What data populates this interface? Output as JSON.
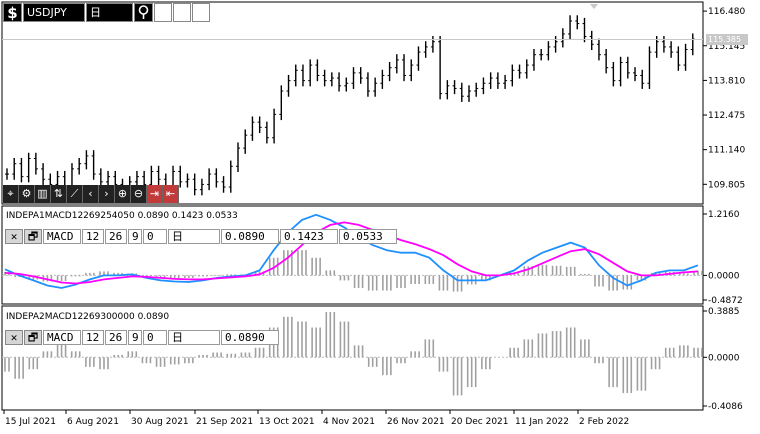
{
  "header": {
    "symbol_icon": "$",
    "symbol": "USDJPY",
    "timeframe": "日",
    "pin_icon": "map-pin-icon"
  },
  "price_axis": {
    "labels": [
      "116.480",
      "115.145",
      "113.810",
      "112.475",
      "111.140",
      "109.805"
    ],
    "current_price": "115.385",
    "current_value": 115.385
  },
  "toolbar": {
    "icons": [
      "crosshair-icon",
      "gear-icon",
      "bar-chart-icon",
      "sort-icon",
      "draw-line-icon",
      "scroll-left-icon",
      "scroll-right-icon",
      "zoom-in-icon",
      "zoom-out-icon",
      "arrow-in-icon",
      "arrow-out-icon"
    ]
  },
  "indicator1": {
    "title": "INDEPA1MACD12269254050 0.0890 0.1423 0.0533",
    "close_label": "✕",
    "window_label": "🗗",
    "name": "MACD",
    "params": [
      "12",
      "26",
      "9",
      "0"
    ],
    "timeframe": "日",
    "values": [
      "0.0890",
      "0.1423",
      "0.0533"
    ],
    "axis_labels": [
      "1.2160",
      "0.0000",
      "-0.4872"
    ]
  },
  "indicator2": {
    "title": "INDEPA2MACD12269300000 0.0890",
    "close_label": "✕",
    "window_label": "🗗",
    "name": "MACD",
    "params": [
      "12",
      "26",
      "9",
      "0"
    ],
    "timeframe": "日",
    "value": "0.0890",
    "axis_labels": [
      "0.3885",
      "0.0000",
      "-0.4086"
    ]
  },
  "time_axis": {
    "labels": [
      "15 Jul 2021",
      "6 Aug 2021",
      "30 Aug 2021",
      "21 Sep 2021",
      "13 Oct 2021",
      "4 Nov 2021",
      "26 Nov 2021",
      "20 Dec 2021",
      "11 Jan 2022",
      "2 Feb 2022"
    ]
  },
  "colors": {
    "macd_line": "#1e90ff",
    "signal_line": "#ff00ff",
    "histogram": "#a0a0a0",
    "candle": "#000000",
    "toolbar_red": "#c23b3b"
  },
  "chart_data": [
    {
      "type": "line",
      "title": "",
      "note_type": "candlestick",
      "series": [
        {
          "name": "USDJPY",
          "values": [
            110.2,
            110.6,
            110.1,
            110.8,
            110.4,
            110.0,
            109.8,
            110.1,
            109.7,
            110.4,
            110.6,
            110.9,
            110.2,
            109.9,
            110.1,
            109.8,
            109.6,
            109.9,
            110.1,
            109.8,
            110.3,
            110.0,
            109.7,
            110.3,
            109.9,
            110.0,
            109.6,
            109.8,
            110.2,
            109.9,
            109.7,
            110.5,
            111.2,
            111.7,
            112.2,
            112.0,
            111.6,
            112.5,
            113.4,
            113.8,
            114.2,
            113.8,
            114.4,
            114.0,
            113.8,
            113.9,
            113.6,
            113.7,
            114.1,
            113.9,
            113.4,
            113.7,
            114.0,
            114.3,
            114.6,
            114.0,
            114.4,
            114.9,
            115.1,
            115.3,
            113.3,
            113.6,
            113.5,
            113.2,
            113.4,
            113.5,
            113.7,
            113.9,
            113.7,
            113.8,
            114.2,
            114.1,
            114.4,
            114.8,
            114.8,
            115.1,
            115.3,
            115.6,
            116.1,
            116.0,
            115.5,
            115.2,
            114.8,
            114.3,
            113.8,
            114.5,
            114.1,
            114.0,
            113.7,
            114.9,
            115.3,
            115.1,
            114.9,
            114.4,
            115.0,
            115.4
          ]
        }
      ],
      "ylim": [
        109.2,
        116.6
      ]
    },
    {
      "type": "line",
      "title": "",
      "series": [
        {
          "name": "MACD",
          "values": [
            0.12,
            0.0,
            -0.1,
            -0.2,
            -0.25,
            -0.18,
            -0.08,
            0.0,
            0.0,
            0.02,
            -0.05,
            -0.1,
            -0.12,
            -0.13,
            -0.1,
            -0.05,
            -0.02,
            0.0,
            0.1,
            0.5,
            0.85,
            1.1,
            1.2,
            1.1,
            0.95,
            0.75,
            0.6,
            0.5,
            0.45,
            0.45,
            0.35,
            0.1,
            -0.1,
            -0.1,
            -0.1,
            0.0,
            0.1,
            0.3,
            0.45,
            0.55,
            0.65,
            0.55,
            0.2,
            -0.05,
            -0.2,
            -0.1,
            0.05,
            0.1,
            0.1,
            0.2
          ]
        },
        {
          "name": "Signal",
          "values": [
            0.05,
            0.03,
            -0.02,
            -0.08,
            -0.14,
            -0.16,
            -0.13,
            -0.08,
            -0.05,
            -0.02,
            -0.03,
            -0.05,
            -0.07,
            -0.08,
            -0.08,
            -0.06,
            -0.04,
            -0.02,
            0.02,
            0.15,
            0.35,
            0.6,
            0.85,
            1.0,
            1.05,
            1.0,
            0.9,
            0.8,
            0.7,
            0.62,
            0.52,
            0.4,
            0.22,
            0.08,
            0.0,
            0.0,
            0.04,
            0.12,
            0.24,
            0.36,
            0.48,
            0.52,
            0.42,
            0.25,
            0.08,
            0.0,
            0.0,
            0.03,
            0.06,
            0.08
          ]
        }
      ],
      "histogram": [
        0.07,
        -0.03,
        -0.08,
        -0.12,
        -0.11,
        -0.02,
        0.05,
        0.08,
        0.05,
        0.04,
        -0.02,
        -0.05,
        -0.05,
        -0.05,
        -0.02,
        0.01,
        0.02,
        0.02,
        0.08,
        0.35,
        0.5,
        0.5,
        0.35,
        0.1,
        -0.1,
        -0.25,
        -0.3,
        -0.3,
        -0.25,
        -0.17,
        -0.17,
        -0.3,
        -0.32,
        -0.18,
        -0.1,
        0.0,
        0.06,
        0.18,
        0.21,
        0.19,
        0.17,
        0.03,
        -0.22,
        -0.3,
        -0.28,
        -0.1,
        0.05,
        0.07,
        0.04,
        0.09
      ],
      "ylim": [
        -0.4872,
        1.216
      ]
    },
    {
      "type": "bar",
      "title": "",
      "values": [
        -0.12,
        -0.18,
        -0.1,
        0.05,
        0.12,
        0.05,
        -0.08,
        -0.1,
        0.02,
        0.05,
        -0.05,
        -0.08,
        -0.06,
        -0.05,
        0.02,
        0.04,
        0.03,
        0.04,
        0.08,
        0.25,
        0.34,
        0.3,
        0.25,
        0.38,
        0.3,
        0.1,
        -0.08,
        -0.15,
        -0.05,
        0.05,
        0.15,
        -0.12,
        -0.32,
        -0.25,
        -0.1,
        0.0,
        0.08,
        0.15,
        0.2,
        0.22,
        0.25,
        0.15,
        -0.05,
        -0.25,
        -0.3,
        -0.28,
        -0.1,
        0.08,
        0.1,
        0.08
      ],
      "ylim": [
        -0.4086,
        0.3885
      ]
    }
  ]
}
